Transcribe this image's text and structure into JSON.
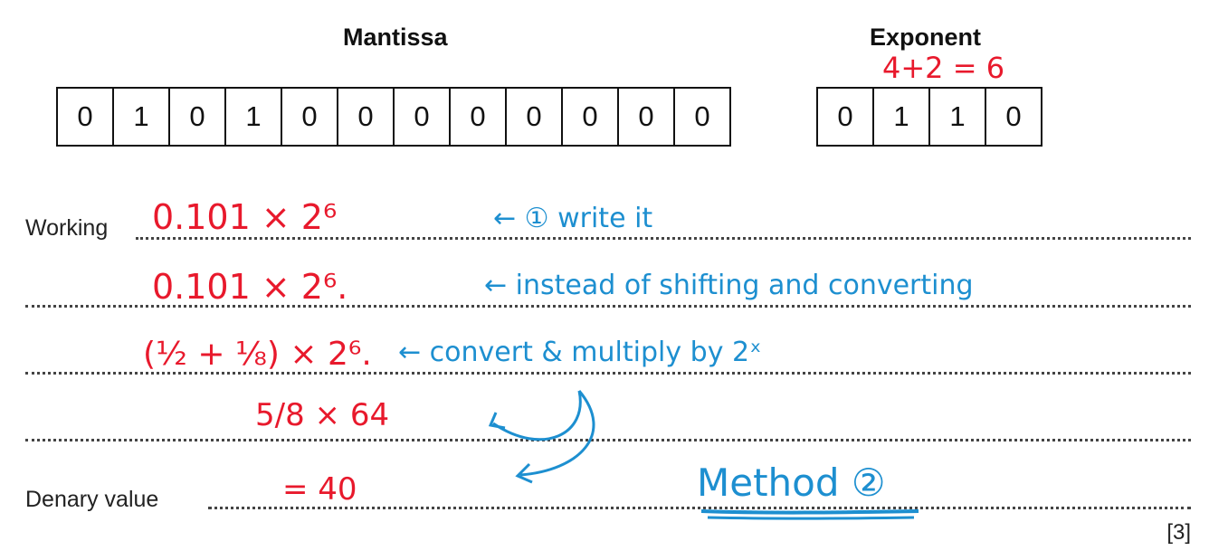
{
  "headings": {
    "mantissa": "Mantissa",
    "exponent": "Exponent"
  },
  "mantissa_bits": [
    "0",
    "1",
    "0",
    "1",
    "0",
    "0",
    "0",
    "0",
    "0",
    "0",
    "0",
    "0"
  ],
  "exponent_bits": [
    "0",
    "1",
    "1",
    "0"
  ],
  "labels": {
    "working": "Working",
    "denary_value": "Denary value",
    "marks": "[3]"
  },
  "annotations": {
    "exponent_sum": "4+2 = 6",
    "line1_math": "0.101 × 2⁶",
    "line1_note": "← ① write it",
    "line2_math": "0.101 × 2⁶.",
    "line2_note": "← instead of shifting and converting",
    "line3_math": "(½ + ⅛) × 2⁶.",
    "line3_note": "← convert & multiply by 2ˣ",
    "line4_math": "5/8 × 64",
    "line5_math": "= 40",
    "method": "Method ②"
  },
  "colors": {
    "red_ink": "#e8192c",
    "blue_ink": "#1d8fd0"
  }
}
